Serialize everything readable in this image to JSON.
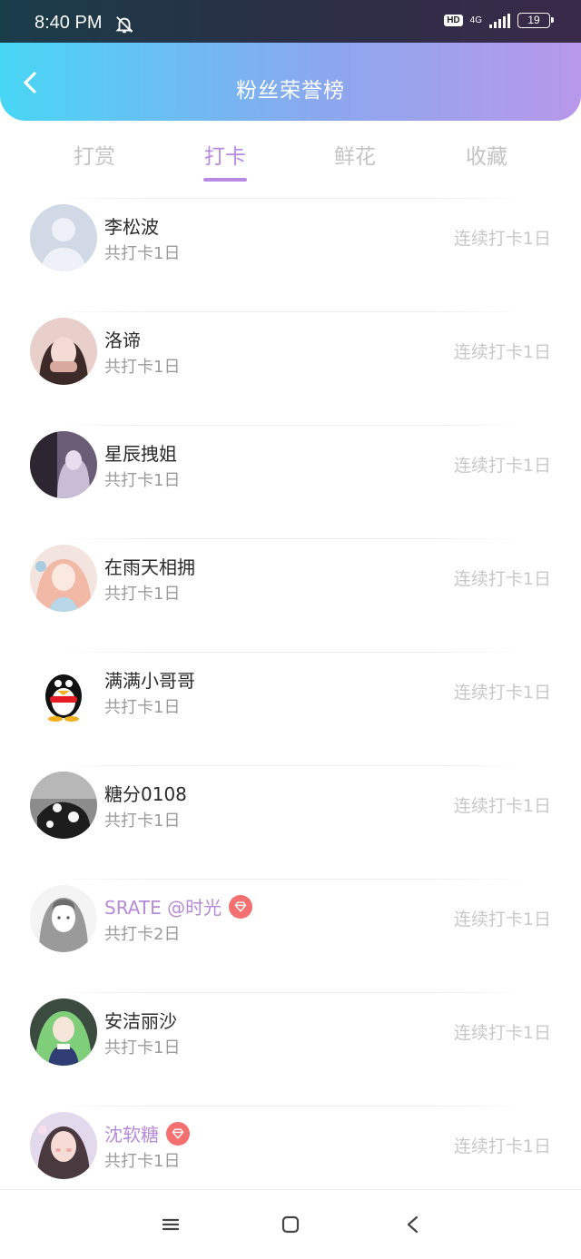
{
  "status_bar": {
    "time": "8:40 PM",
    "bell_icon": "bell-off-icon",
    "hd": "HD",
    "network": "4G",
    "battery": "19"
  },
  "header": {
    "back_icon": "chevron-left-icon",
    "title": "粉丝荣誉榜"
  },
  "tabs": [
    {
      "label": "打赏",
      "active": false
    },
    {
      "label": "打卡",
      "active": true
    },
    {
      "label": "鲜花",
      "active": false
    },
    {
      "label": "收藏",
      "active": false
    }
  ],
  "colors": {
    "accent": "#b98ae3",
    "vip_badge": "#f46f6f",
    "header_gradient": [
      "#48d6f5",
      "#b898ea"
    ]
  },
  "fans": [
    {
      "name": "李松波",
      "total": "共打卡1日",
      "streak": "连续打卡1日",
      "vip": false,
      "avatar": "default-avatar"
    },
    {
      "name": "洛谛",
      "total": "共打卡1日",
      "streak": "连续打卡1日",
      "vip": false,
      "avatar": "photo-avatar"
    },
    {
      "name": "星辰拽姐",
      "total": "共打卡1日",
      "streak": "连续打卡1日",
      "vip": false,
      "avatar": "photo-avatar"
    },
    {
      "name": "在雨天相拥",
      "total": "共打卡1日",
      "streak": "连续打卡1日",
      "vip": false,
      "avatar": "anime-avatar"
    },
    {
      "name": "满满小哥哥",
      "total": "共打卡1日",
      "streak": "连续打卡1日",
      "vip": false,
      "avatar": "penguin-avatar"
    },
    {
      "name": "糖分0108",
      "total": "共打卡1日",
      "streak": "连续打卡1日",
      "vip": false,
      "avatar": "photo-avatar"
    },
    {
      "name": "SRATE @时光",
      "total": "共打卡2日",
      "streak": "连续打卡1日",
      "vip": true,
      "avatar": "sketch-avatar"
    },
    {
      "name": "安洁丽沙",
      "total": "共打卡1日",
      "streak": "连续打卡1日",
      "vip": false,
      "avatar": "anime-avatar"
    },
    {
      "name": "沈软糖",
      "total": "共打卡1日",
      "streak": "连续打卡1日",
      "vip": true,
      "avatar": "photo-avatar"
    }
  ],
  "nav_bar": {
    "menu_icon": "menu-icon",
    "home_icon": "square-home-icon",
    "back_icon": "triangle-back-icon"
  }
}
